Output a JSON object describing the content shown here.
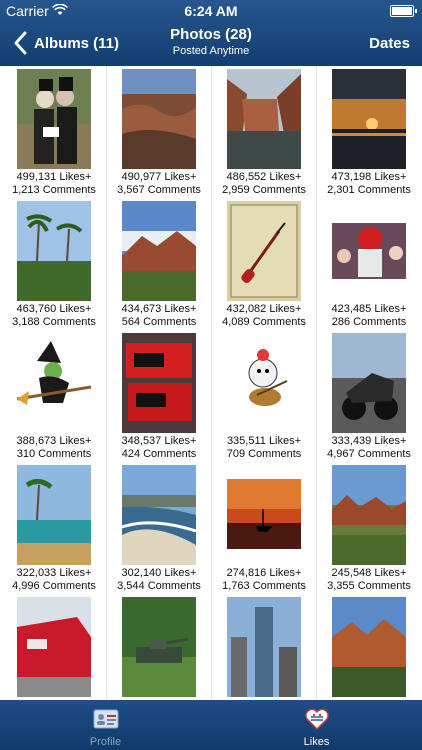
{
  "status": {
    "carrier": "Carrier",
    "time": "6:24 AM"
  },
  "nav": {
    "back_label": "Albums (11)",
    "title": "Photos (28)",
    "subtitle": "Posted Anytime",
    "right_label": "Dates"
  },
  "photos": [
    {
      "likes": "499,131 Likes+",
      "comments": "1,213 Comments",
      "subject": "halloween costume couple"
    },
    {
      "likes": "490,977 Likes+",
      "comments": "3,567 Comments",
      "subject": "canyon landscape"
    },
    {
      "likes": "486,552 Likes+",
      "comments": "2,959 Comments",
      "subject": "canyon river"
    },
    {
      "likes": "473,198 Likes+",
      "comments": "2,301 Comments",
      "subject": "sunset sky"
    },
    {
      "likes": "463,760 Likes+",
      "comments": "3,188 Comments",
      "subject": "palm trees"
    },
    {
      "likes": "434,673 Likes+",
      "comments": "564 Comments",
      "subject": "red rock mountains"
    },
    {
      "likes": "432,082 Likes+",
      "comments": "4,089 Comments",
      "subject": "guitar drawing"
    },
    {
      "likes": "423,485 Likes+",
      "comments": "286 Comments",
      "subject": "mascot at party"
    },
    {
      "likes": "388,673 Likes+",
      "comments": "310 Comments",
      "subject": "witch on broom"
    },
    {
      "likes": "348,537 Likes+",
      "comments": "424 Comments",
      "subject": "wine boxes"
    },
    {
      "likes": "335,511 Likes+",
      "comments": "709 Comments",
      "subject": "cartoon guitarist"
    },
    {
      "likes": "333,439 Likes+",
      "comments": "4,967 Comments",
      "subject": "motorcycle"
    },
    {
      "likes": "322,033 Likes+",
      "comments": "4,996 Comments",
      "subject": "resort pool"
    },
    {
      "likes": "302,140 Likes+",
      "comments": "3,544 Comments",
      "subject": "beach waves"
    },
    {
      "likes": "274,816 Likes+",
      "comments": "1,763 Comments",
      "subject": "sailboat sunset"
    },
    {
      "likes": "245,548 Likes+",
      "comments": "3,355 Comments",
      "subject": "desert valley"
    },
    {
      "likes": "",
      "comments": "",
      "subject": "red car"
    },
    {
      "likes": "",
      "comments": "",
      "subject": "tank monument"
    },
    {
      "likes": "",
      "comments": "",
      "subject": "city skyscraper"
    },
    {
      "likes": "",
      "comments": "",
      "subject": "red rocks trail"
    }
  ],
  "tabs": [
    {
      "label": "Profile",
      "icon": "profile-icon",
      "active": false
    },
    {
      "label": "Likes",
      "icon": "likes-icon",
      "active": true
    }
  ],
  "colors": {
    "header": "#1a4a80",
    "tabbar": "#163f70",
    "tab_inactive": "#8aa3c2"
  }
}
